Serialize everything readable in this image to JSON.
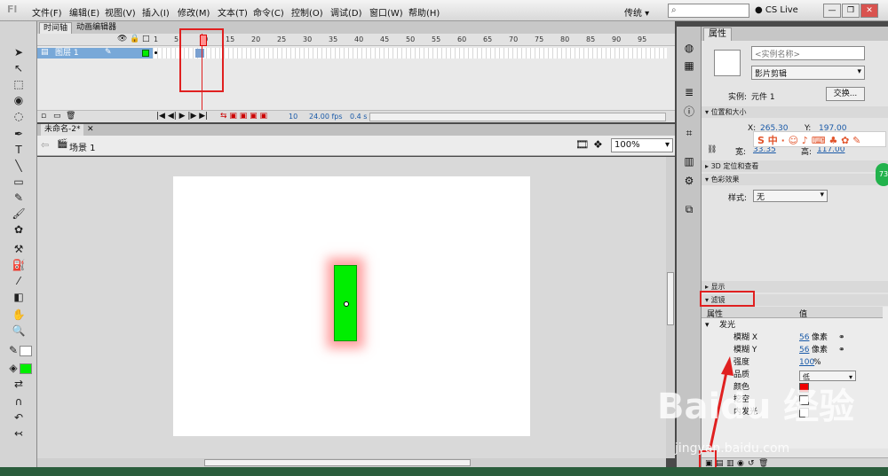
{
  "app": {
    "logo": "Fl"
  },
  "menu": [
    "文件(F)",
    "编辑(E)",
    "视图(V)",
    "插入(I)",
    "修改(M)",
    "文本(T)",
    "命令(C)",
    "控制(O)",
    "调试(D)",
    "窗口(W)",
    "帮助(H)"
  ],
  "workspace": "传统 ▾",
  "search": {
    "placeholder": ""
  },
  "cslive": "CS Live",
  "timeline": {
    "tabs": [
      "时间轴",
      "动画编辑器"
    ],
    "ruler": [
      "1",
      "5",
      "10",
      "15",
      "20",
      "25",
      "30",
      "35",
      "40",
      "45",
      "50",
      "55",
      "60",
      "65",
      "70",
      "75",
      "80",
      "85",
      "90",
      "95"
    ],
    "layer_name": "图层 1",
    "current_frame": "10",
    "fps": "24.00 fps",
    "elapsed": "0.4 s"
  },
  "document": {
    "tab": "未命名-2*",
    "scene": "场景 1",
    "zoom": "100%"
  },
  "properties": {
    "tab": "属性",
    "instance_name_placeholder": "<实例名称>",
    "instance_type": "影片剪辑",
    "instance_of_label": "实例:",
    "instance_of": "元件 1",
    "swap_label": "交换...",
    "pos_section": "位置和大小",
    "x_label": "X:",
    "x_value": "265.30",
    "y_label": "Y:",
    "y_value": "197.00",
    "w_label": "宽:",
    "w_value": "33.35",
    "h_label": "高:",
    "h_value": "117.00",
    "sec_3d": "3D 定位和查看",
    "sec_color": "色彩效果",
    "style_label": "样式:",
    "style_value": "无",
    "sec_display": "显示",
    "sec_filters": "滤镜",
    "filter_col_prop": "属性",
    "filter_col_val": "值",
    "filter_name": "发光",
    "blur_x_label": "模糊 X",
    "blur_x": "56",
    "blur_unit": "像素",
    "blur_y_label": "模糊 Y",
    "blur_y": "56",
    "strength_label": "强度",
    "strength": "100",
    "strength_unit": "%",
    "quality_label": "品质",
    "quality": "低",
    "color_label": "颜色",
    "color": "#ee0000",
    "knockout_label": "挖空",
    "inner_label": "内发光"
  },
  "ime": "S 中 · ☺ ♪ ⌨ ♣ ✿ ✎",
  "badge": "73",
  "watermark": {
    "main": "Baidu 经验",
    "sub": "jingyan.baidu.com"
  }
}
